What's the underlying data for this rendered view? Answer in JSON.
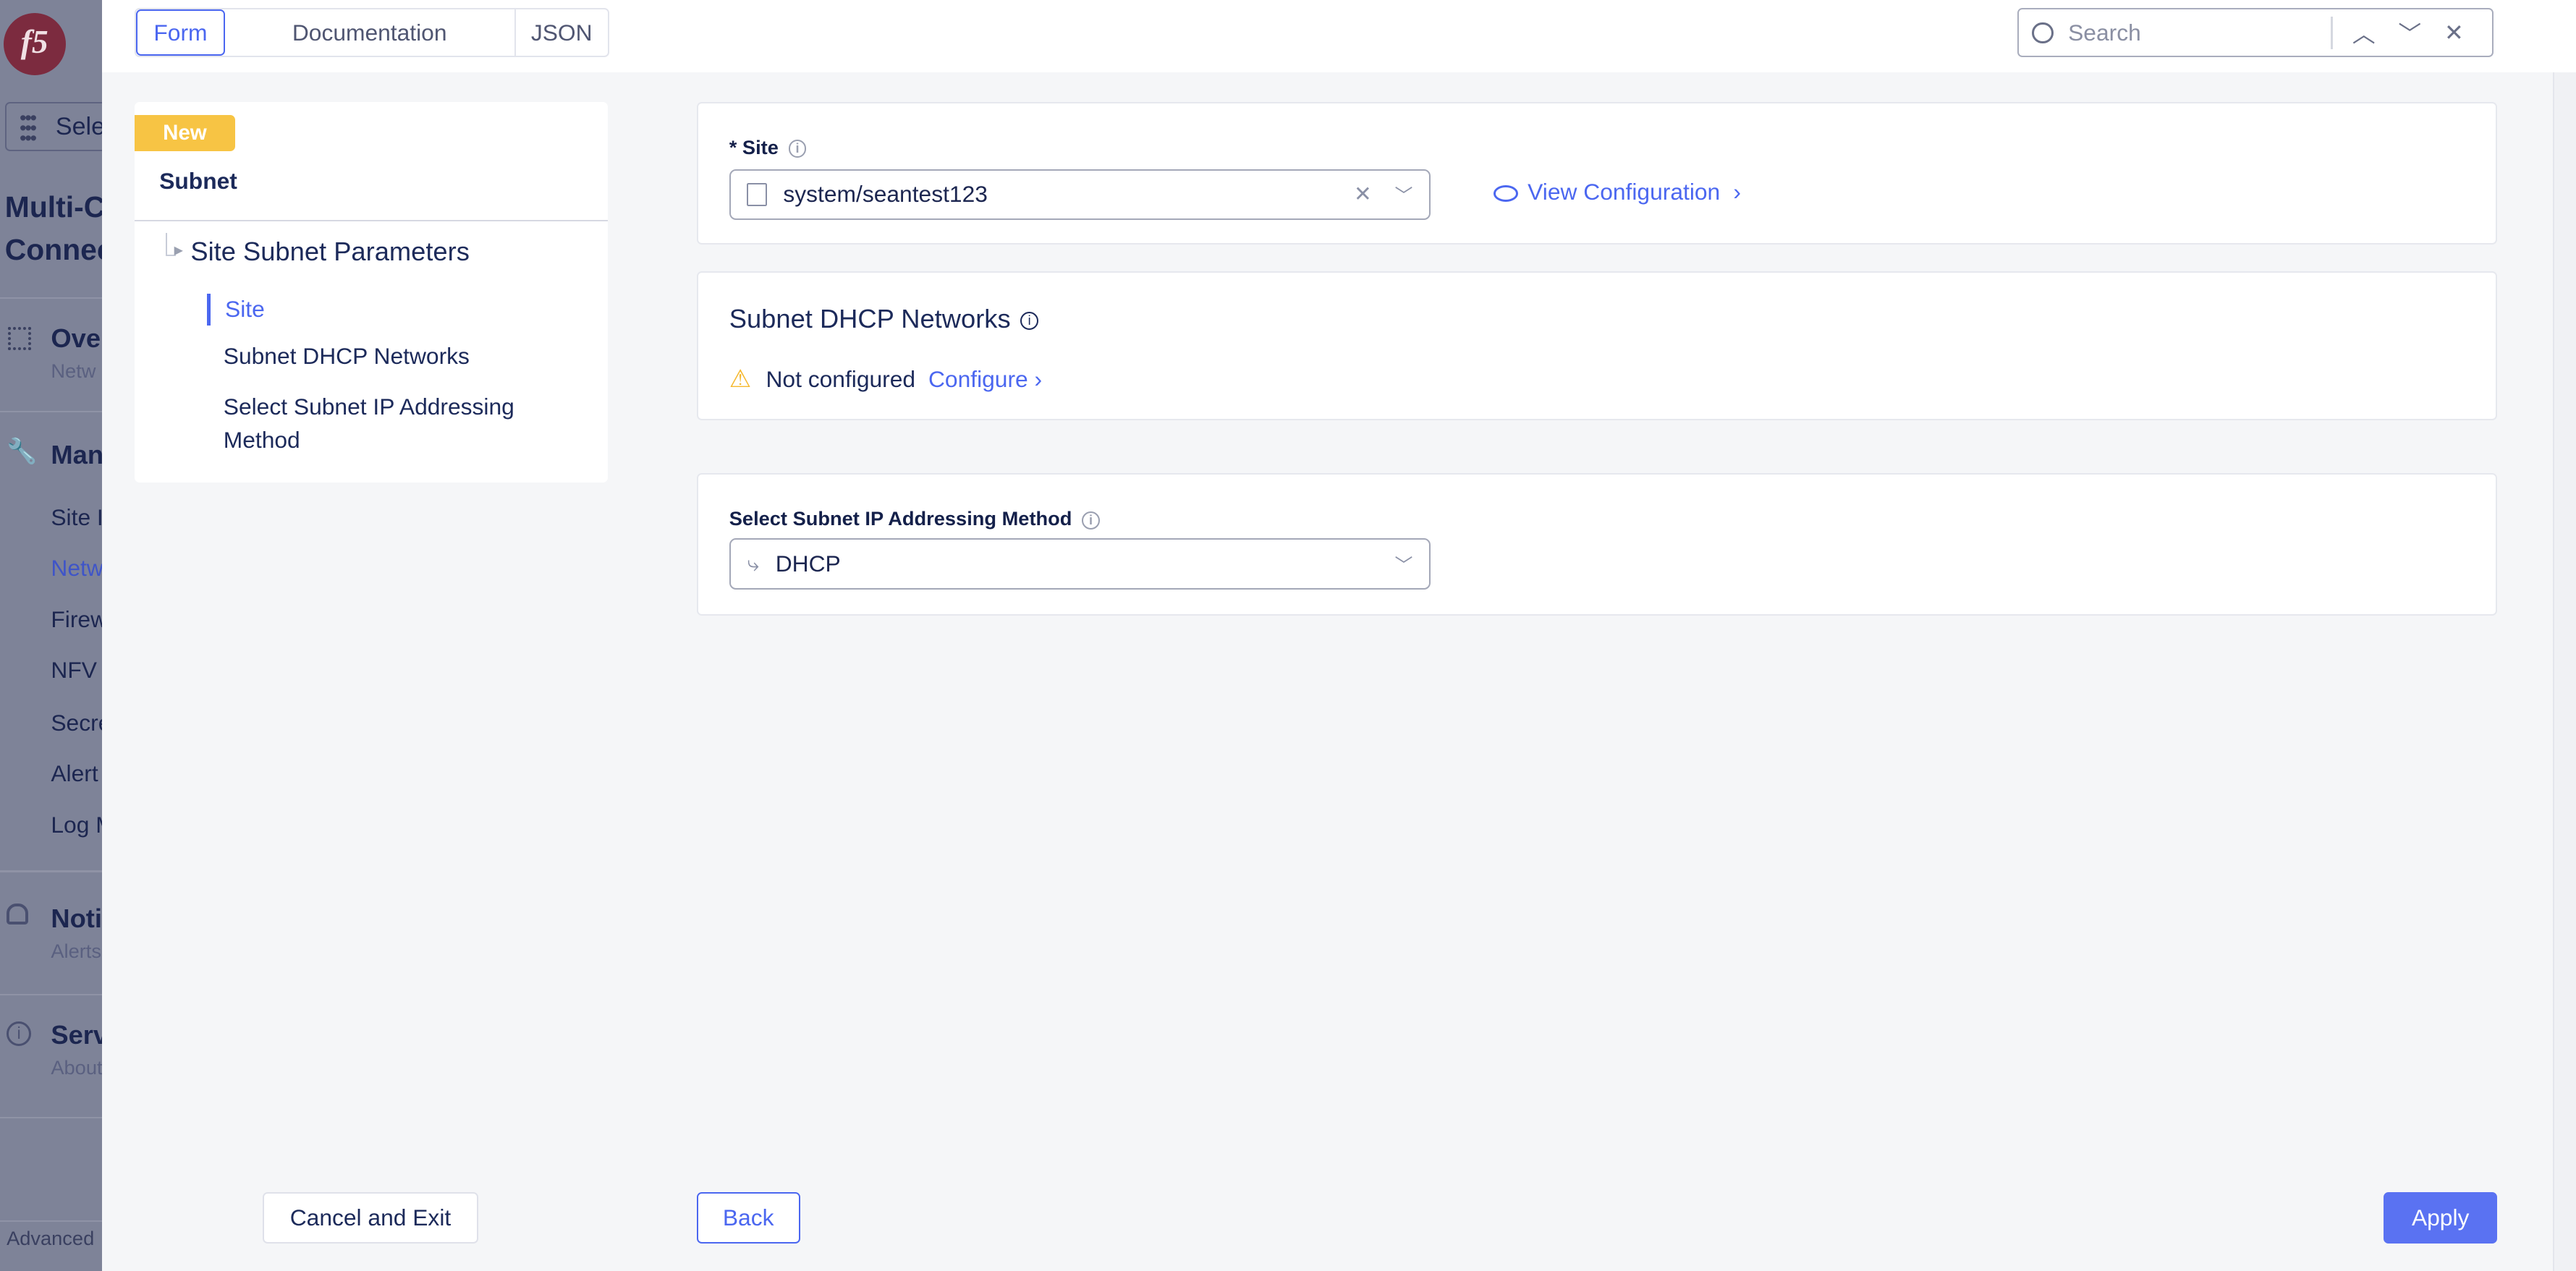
{
  "sidebar": {
    "logo": "f5",
    "select_label": "Sele",
    "title_line1": "Multi-C",
    "title_line2": "Connec",
    "sections": [
      {
        "icon": "grid-icon",
        "title": "Over",
        "subtitle": "Netw"
      },
      {
        "icon": "wrench-icon",
        "title": "Man"
      },
      {
        "icon": "bell-icon",
        "title": "Noti",
        "subtitle": "Alerts"
      },
      {
        "icon": "info-icon",
        "title": "Serv",
        "subtitle": "About"
      }
    ],
    "items": [
      "Site I",
      "Netw",
      "Firew",
      "NFV",
      "Secre",
      "Alert",
      "Log M"
    ],
    "footer": "Advanced"
  },
  "topbar": {
    "tabs": [
      "Form",
      "Documentation",
      "JSON"
    ],
    "active_tab": "Form",
    "search_placeholder": "Search"
  },
  "outline": {
    "badge": "New",
    "title": "Subnet",
    "group": "Site Subnet Parameters",
    "items": [
      "Site",
      "Subnet DHCP Networks",
      "Select Subnet IP Addressing Method"
    ],
    "active_item": "Site"
  },
  "form": {
    "site": {
      "label": "* Site",
      "value": "system/seantest123",
      "view_link": "View Configuration"
    },
    "dhcp_networks": {
      "title": "Subnet DHCP Networks",
      "status": "Not configured",
      "configure_link": "Configure"
    },
    "ip_method": {
      "label": "Select Subnet IP Addressing Method",
      "value": "DHCP"
    }
  },
  "footer": {
    "cancel": "Cancel and Exit",
    "back": "Back",
    "apply": "Apply"
  },
  "colors": {
    "accent": "#4b67f0",
    "badge": "#f7c444",
    "warning": "#f5b82e",
    "apply": "#5a72f2"
  }
}
